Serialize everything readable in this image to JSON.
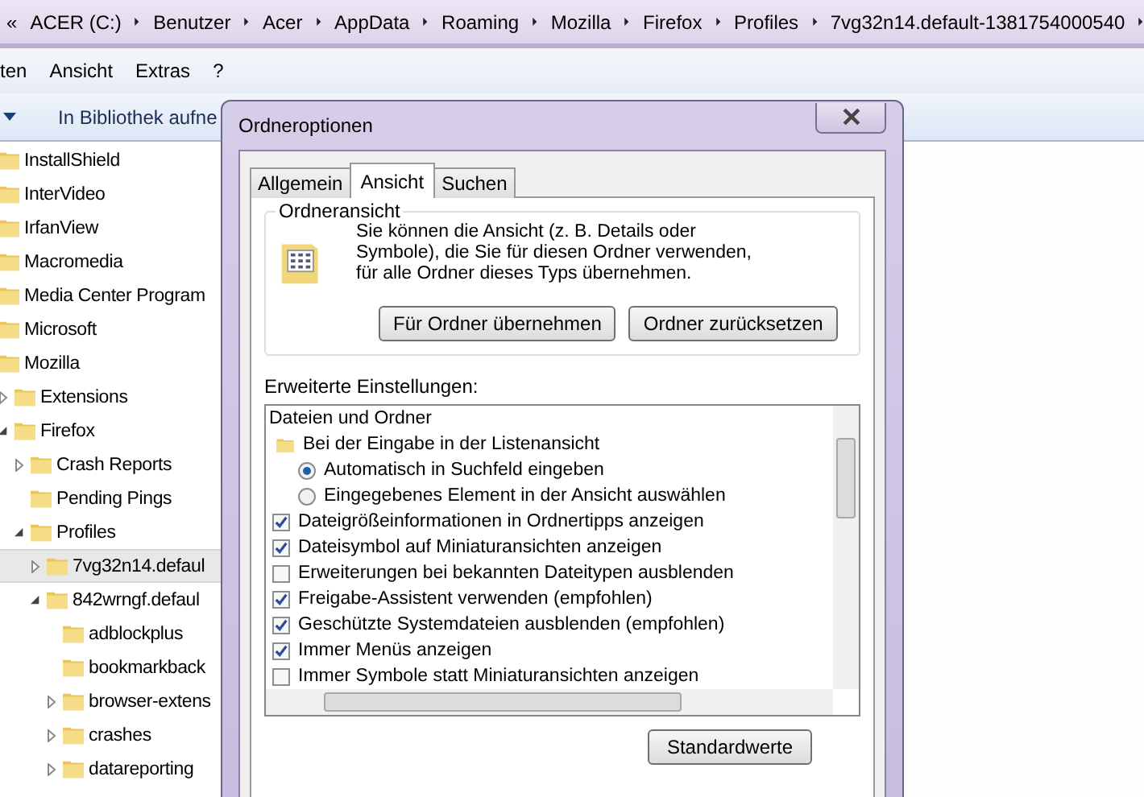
{
  "address_bar": {
    "overflow_glyph": "«",
    "segments": [
      "ACER (C:)",
      "Benutzer",
      "Acer",
      "AppData",
      "Roaming",
      "Mozilla",
      "Firefox",
      "Profiles",
      "7vg32n14.default-1381754000540"
    ]
  },
  "menu": [
    "ten",
    "Ansicht",
    "Extras",
    "?"
  ],
  "toolbar": {
    "button": "In Bibliothek aufne"
  },
  "tree": [
    {
      "label": "InstallShield",
      "selected": false
    },
    {
      "label": "InterVideo",
      "selected": false
    },
    {
      "label": "IrfanView",
      "selected": false
    },
    {
      "label": "Macromedia",
      "selected": false
    },
    {
      "label": "Media Center Program",
      "selected": false
    },
    {
      "label": "Microsoft",
      "selected": false
    },
    {
      "label": "Mozilla",
      "selected": false,
      "children": [
        {
          "label": "Extensions",
          "expanded": false,
          "selected": false
        },
        {
          "label": "Firefox",
          "expanded": true,
          "selected": false,
          "children": [
            {
              "label": "Crash Reports",
              "expanded": false,
              "selected": false
            },
            {
              "label": "Pending Pings",
              "selected": false
            },
            {
              "label": "Profiles",
              "expanded": true,
              "selected": false,
              "children": [
                {
                  "label": "7vg32n14.defaul",
                  "expanded": false,
                  "selected": true
                },
                {
                  "label": "842wrngf.defaul",
                  "expanded": true,
                  "selected": false,
                  "children": [
                    {
                      "label": "adblockplus",
                      "selected": false
                    },
                    {
                      "label": "bookmarkback",
                      "selected": false
                    },
                    {
                      "label": "browser-extens",
                      "expanded": false,
                      "selected": false
                    },
                    {
                      "label": "crashes",
                      "expanded": false,
                      "selected": false
                    },
                    {
                      "label": "datareporting",
                      "expanded": false,
                      "selected": false
                    }
                  ]
                }
              ]
            }
          ]
        }
      ]
    }
  ],
  "dialog": {
    "title": "Ordneroptionen",
    "tabs": [
      {
        "label": "Allgemein",
        "selected": false
      },
      {
        "label": "Ansicht",
        "selected": true
      },
      {
        "label": "Suchen",
        "selected": false
      }
    ],
    "folder_view": {
      "legend": "Ordneransicht",
      "text": "Sie können die Ansicht (z. B. Details oder Symbole), die Sie für diesen Ordner verwenden, für alle Ordner dieses Typs übernehmen.",
      "buttons": [
        "Für Ordner übernehmen",
        "Ordner zurücksetzen"
      ]
    },
    "advanced": {
      "label": "Erweiterte Einstellungen:",
      "items": [
        {
          "kind": "header",
          "text": "Dateien und Ordner"
        },
        {
          "kind": "folder",
          "text": "Bei der Eingabe in der Listenansicht"
        },
        {
          "kind": "radio",
          "text": "Automatisch in Suchfeld eingeben",
          "selected": true
        },
        {
          "kind": "radio",
          "text": "Eingegebenes Element in der Ansicht auswählen",
          "selected": false
        },
        {
          "kind": "checkbox",
          "text": "Dateigrößeinformationen in Ordnertipps anzeigen",
          "checked": true
        },
        {
          "kind": "checkbox",
          "text": "Dateisymbol auf Miniaturansichten anzeigen",
          "checked": true
        },
        {
          "kind": "checkbox",
          "text": "Erweiterungen bei bekannten Dateitypen ausblenden",
          "checked": false
        },
        {
          "kind": "checkbox",
          "text": "Freigabe-Assistent verwenden (empfohlen)",
          "checked": true
        },
        {
          "kind": "checkbox",
          "text": "Geschützte Systemdateien ausblenden (empfohlen)",
          "checked": true
        },
        {
          "kind": "checkbox",
          "text": "Immer Menüs anzeigen",
          "checked": true
        },
        {
          "kind": "checkbox",
          "text": "Immer Symbole statt Miniaturansichten anzeigen",
          "checked": false
        }
      ]
    },
    "defaults_button": "Standardwerte"
  }
}
